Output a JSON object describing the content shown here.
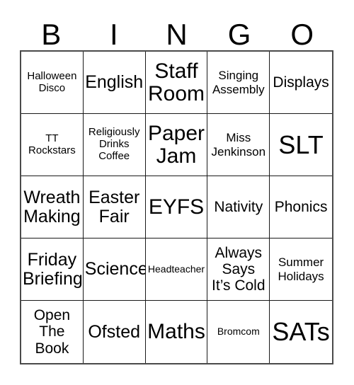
{
  "header": {
    "letters": [
      "B",
      "I",
      "N",
      "G",
      "O"
    ]
  },
  "grid": {
    "columns": 5,
    "rows": 5,
    "cells": [
      {
        "text": "Halloween\nDisco",
        "size": "sz-s"
      },
      {
        "text": "English",
        "size": "sz-xl"
      },
      {
        "text": "Staff\nRoom",
        "size": "sz-xxl"
      },
      {
        "text": "Singing\nAssembly",
        "size": "sz-m"
      },
      {
        "text": "Displays",
        "size": "sz-l"
      },
      {
        "text": "TT\nRockstars",
        "size": "sz-s"
      },
      {
        "text": "Religiously\nDrinks\nCoffee",
        "size": "sz-s"
      },
      {
        "text": "Paper\nJam",
        "size": "sz-xxl"
      },
      {
        "text": "Miss\nJenkinson",
        "size": "sz-m"
      },
      {
        "text": "SLT",
        "size": "sz-hg"
      },
      {
        "text": "Wreath\nMaking",
        "size": "sz-xl"
      },
      {
        "text": "Easter\nFair",
        "size": "sz-xl"
      },
      {
        "text": "EYFS",
        "size": "sz-xxl"
      },
      {
        "text": "Nativity",
        "size": "sz-l"
      },
      {
        "text": "Phonics",
        "size": "sz-l"
      },
      {
        "text": "Friday\nBriefing",
        "size": "sz-xl"
      },
      {
        "text": "Science",
        "size": "sz-xl"
      },
      {
        "text": "Headteacher",
        "size": "sz-xs"
      },
      {
        "text": "Always\nSays\nIt’s Cold",
        "size": "sz-l"
      },
      {
        "text": "Summer\nHolidays",
        "size": "sz-m"
      },
      {
        "text": "Open\nThe\nBook",
        "size": "sz-l"
      },
      {
        "text": "Ofsted",
        "size": "sz-xl"
      },
      {
        "text": "Maths",
        "size": "sz-xxl"
      },
      {
        "text": "Bromcom",
        "size": "sz-xs"
      },
      {
        "text": "SATs",
        "size": "sz-hg"
      }
    ]
  },
  "colors": {
    "background": "#ffffff",
    "text": "#000000",
    "grid_line": "#1a1a1a",
    "grid_outer": "#4a4a4a"
  }
}
